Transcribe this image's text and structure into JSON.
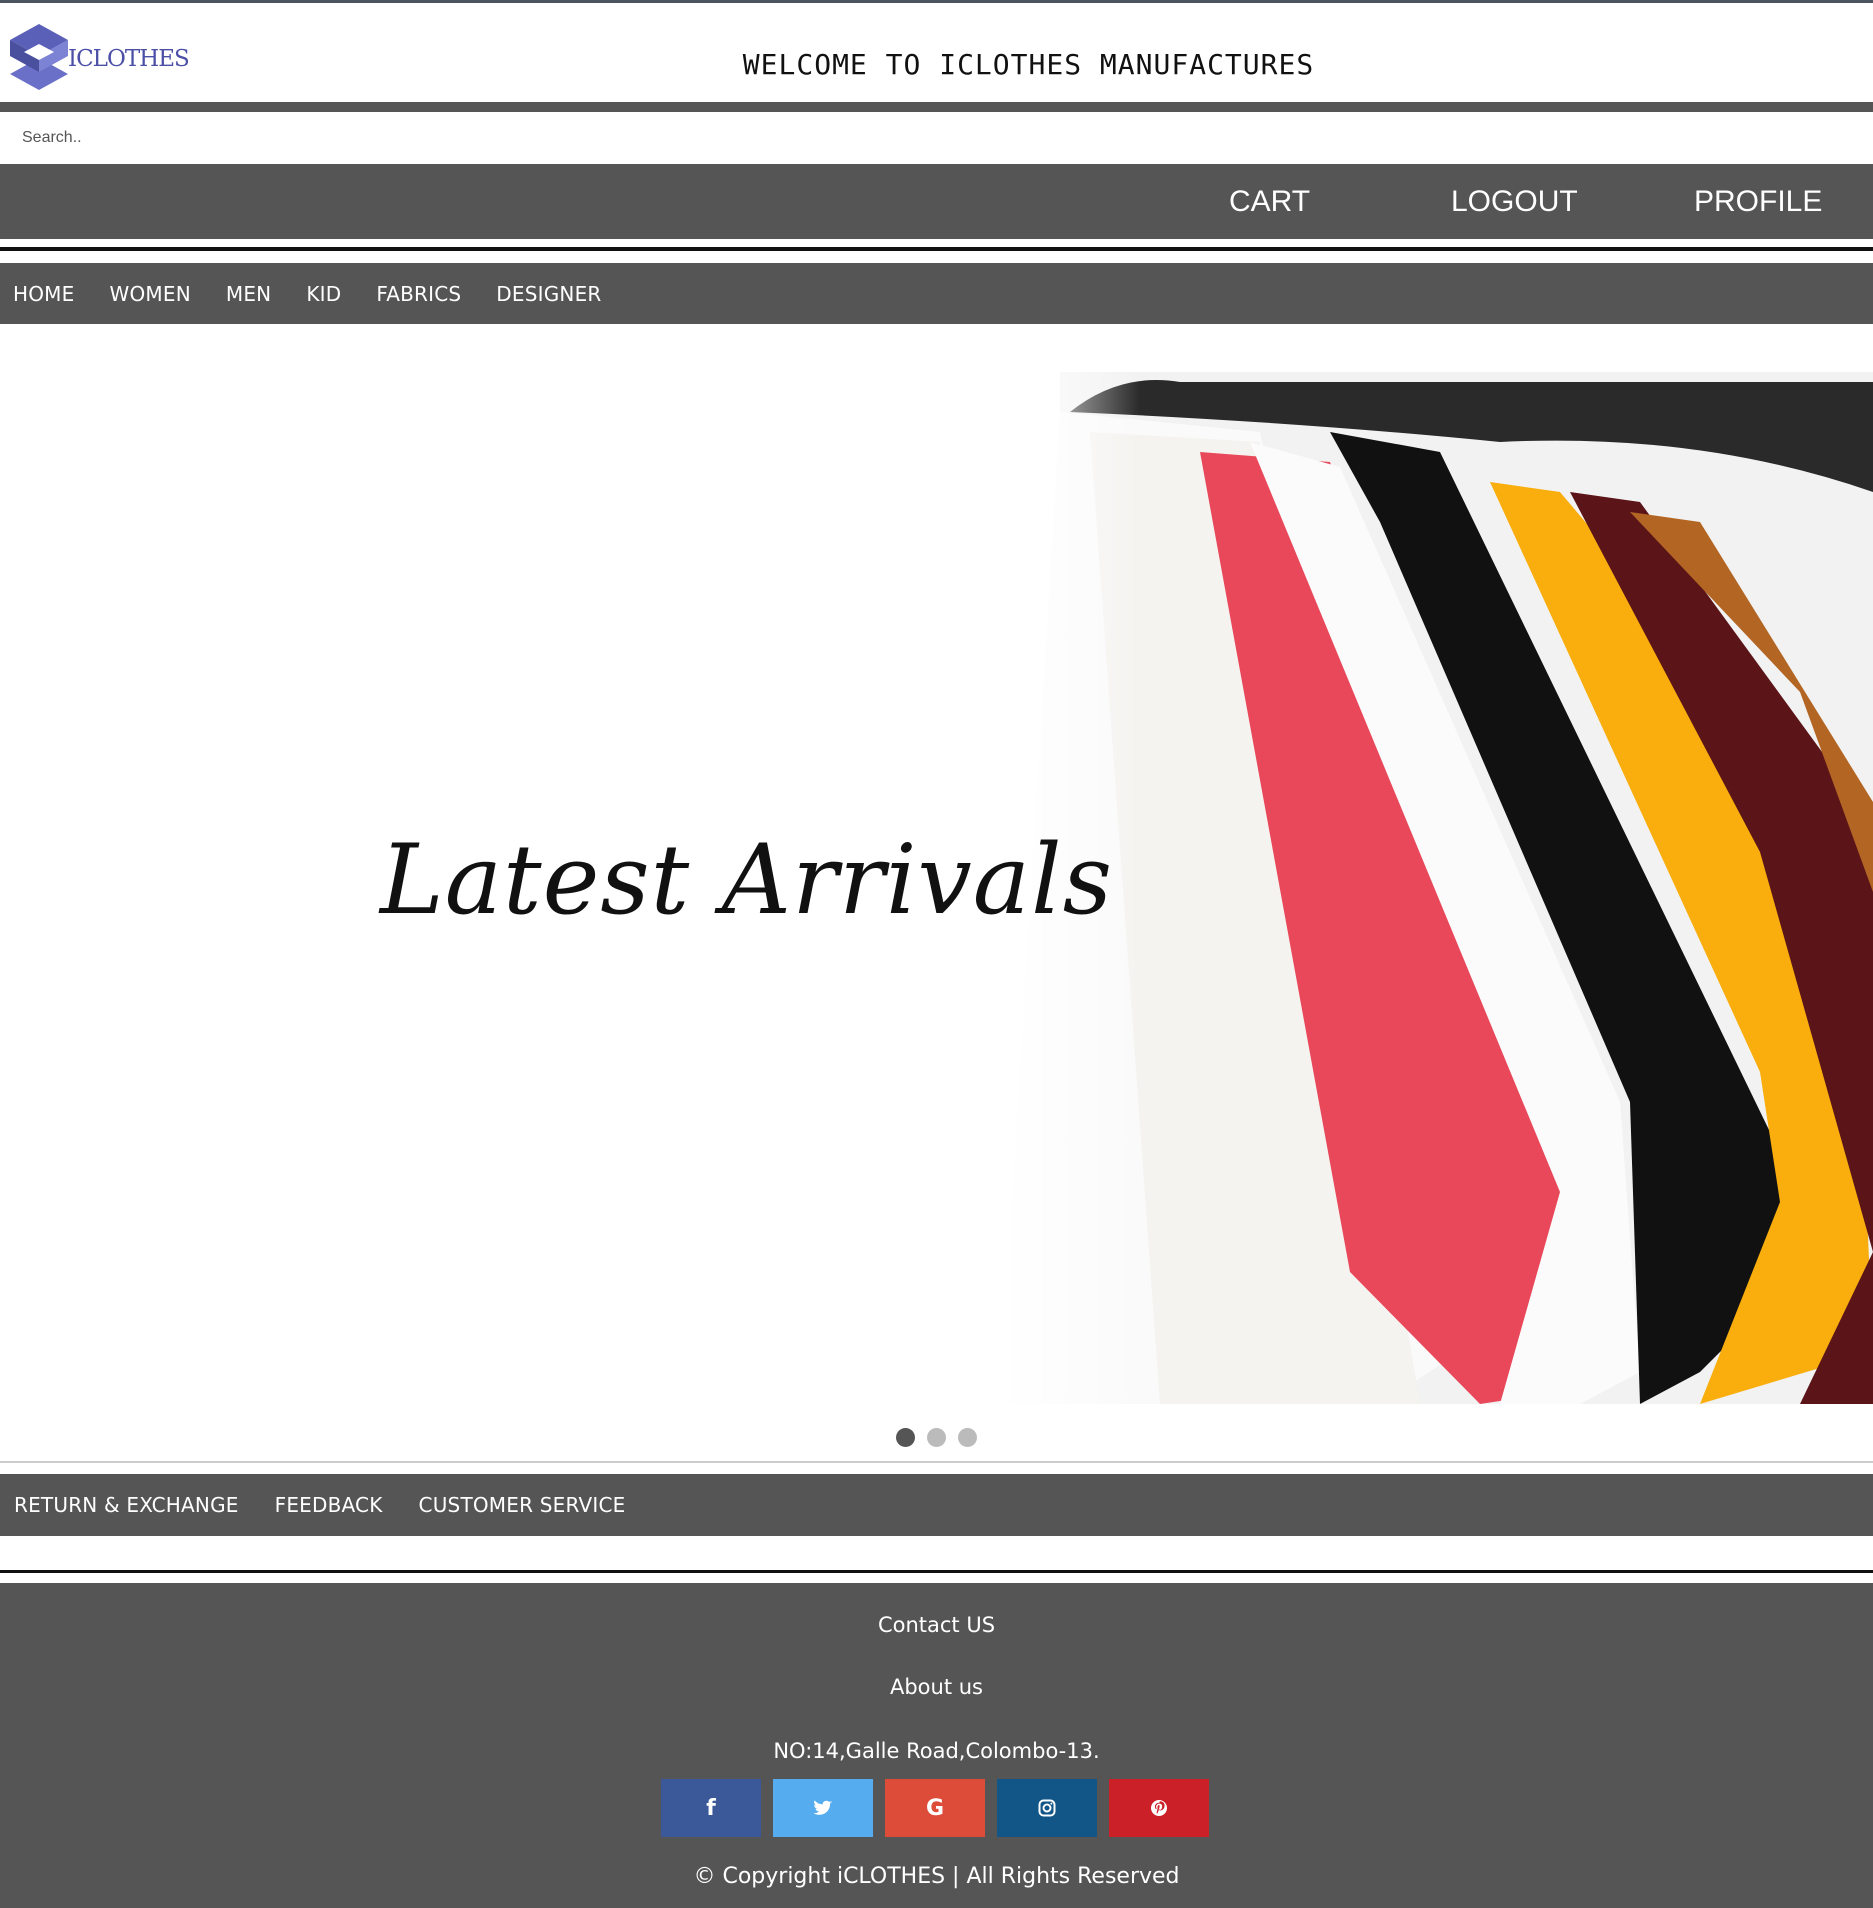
{
  "header": {
    "logo_text": "ICLOTHES",
    "title": "WELCOME TO ICLOTHES MANUFACTURES"
  },
  "search": {
    "placeholder": "Search.."
  },
  "account_nav": {
    "cart": "CART",
    "logout": "LOGOUT",
    "profile": "PROFILE"
  },
  "main_nav": {
    "items": [
      "HOME",
      "WOMEN",
      "MEN",
      "KID",
      "FABRICS",
      "DESIGNER"
    ]
  },
  "banner": {
    "title": "Latest Arrivals",
    "active_slide": 1,
    "slide_count": 3
  },
  "service_nav": {
    "items": [
      "RETURN & EXCHANGE",
      "FEEDBACK",
      "CUSTOMER SERVICE"
    ]
  },
  "footer": {
    "contact": "Contact US",
    "about": "About us",
    "address": "NO:14,Galle Road,Colombo-13.",
    "copyright": "© Copyright iCLOTHES | All Rights Reserved",
    "socials": [
      {
        "name": "facebook",
        "icon": "facebook-icon",
        "color": "#3b5998",
        "glyph": "f"
      },
      {
        "name": "twitter",
        "icon": "twitter-icon",
        "color": "#55acee",
        "glyph": ""
      },
      {
        "name": "google",
        "icon": "google-icon",
        "color": "#dd4b39",
        "glyph": "G"
      },
      {
        "name": "instagram",
        "icon": "instagram-icon",
        "color": "#125688",
        "glyph": ""
      },
      {
        "name": "pinterest",
        "icon": "pinterest-icon",
        "color": "#cb2027",
        "glyph": ""
      }
    ]
  },
  "colors": {
    "nav_bg": "#555555",
    "logo": "#4b4fa6"
  }
}
